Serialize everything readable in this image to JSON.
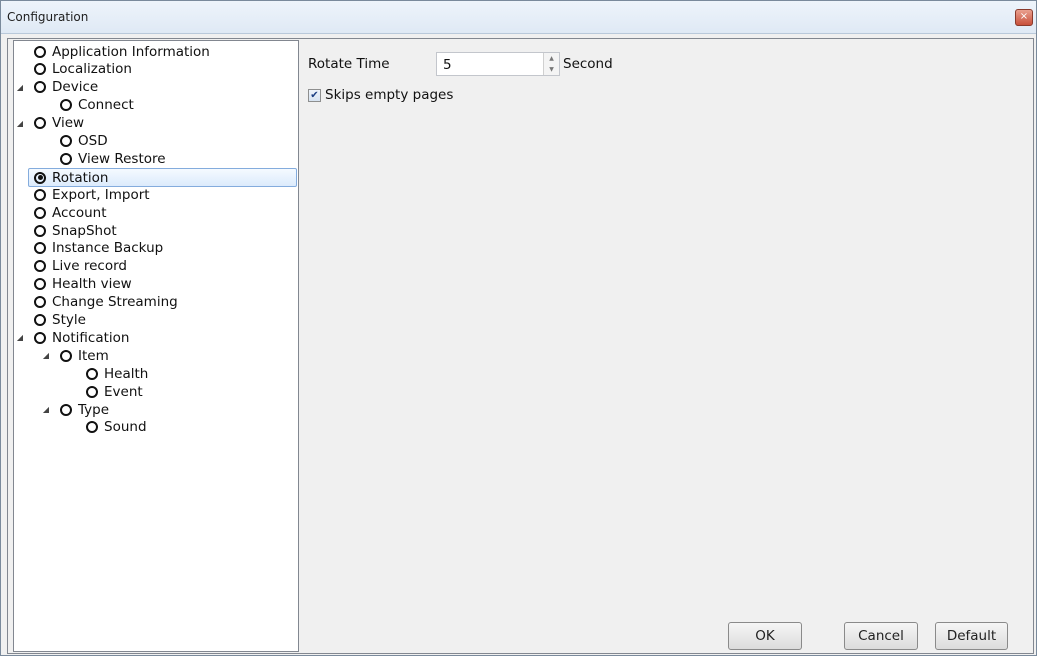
{
  "window": {
    "title": "Configuration",
    "close_icon": "×"
  },
  "tree": {
    "items": [
      {
        "label": "Application Information",
        "level": 0,
        "expander": "",
        "selected": false
      },
      {
        "label": "Localization",
        "level": 0,
        "expander": "",
        "selected": false
      },
      {
        "label": "Device",
        "level": 0,
        "expander": "◢",
        "selected": false
      },
      {
        "label": "Connect",
        "level": 1,
        "expander": "",
        "selected": false
      },
      {
        "label": "View",
        "level": 0,
        "expander": "◢",
        "selected": false
      },
      {
        "label": "OSD",
        "level": 1,
        "expander": "",
        "selected": false
      },
      {
        "label": "View Restore",
        "level": 1,
        "expander": "",
        "selected": false
      },
      {
        "label": "Rotation",
        "level": 0,
        "expander": "",
        "selected": true
      },
      {
        "label": "Export, Import",
        "level": 0,
        "expander": "",
        "selected": false
      },
      {
        "label": "Account",
        "level": 0,
        "expander": "",
        "selected": false
      },
      {
        "label": "SnapShot",
        "level": 0,
        "expander": "",
        "selected": false
      },
      {
        "label": "Instance Backup",
        "level": 0,
        "expander": "",
        "selected": false
      },
      {
        "label": "Live record",
        "level": 0,
        "expander": "",
        "selected": false
      },
      {
        "label": "Health view",
        "level": 0,
        "expander": "",
        "selected": false
      },
      {
        "label": "Change Streaming",
        "level": 0,
        "expander": "",
        "selected": false
      },
      {
        "label": "Style",
        "level": 0,
        "expander": "",
        "selected": false
      },
      {
        "label": "Notification",
        "level": 0,
        "expander": "◢",
        "selected": false
      },
      {
        "label": "Item",
        "level": 1,
        "expander": "◢",
        "selected": false
      },
      {
        "label": "Health",
        "level": 2,
        "expander": "",
        "selected": false
      },
      {
        "label": "Event",
        "level": 2,
        "expander": "",
        "selected": false
      },
      {
        "label": "Type",
        "level": 1,
        "expander": "◢",
        "selected": false
      },
      {
        "label": "Sound",
        "level": 2,
        "expander": "",
        "selected": false
      }
    ]
  },
  "rotation": {
    "rotate_time_label": "Rotate Time",
    "rotate_time_value": "5",
    "unit_label": "Second",
    "spin_up": "▲",
    "spin_down": "▼",
    "skip_empty_label": "Skips empty pages",
    "skip_empty_checked": true,
    "check_mark": "✔"
  },
  "buttons": {
    "ok": "OK",
    "cancel": "Cancel",
    "default": "Default"
  }
}
